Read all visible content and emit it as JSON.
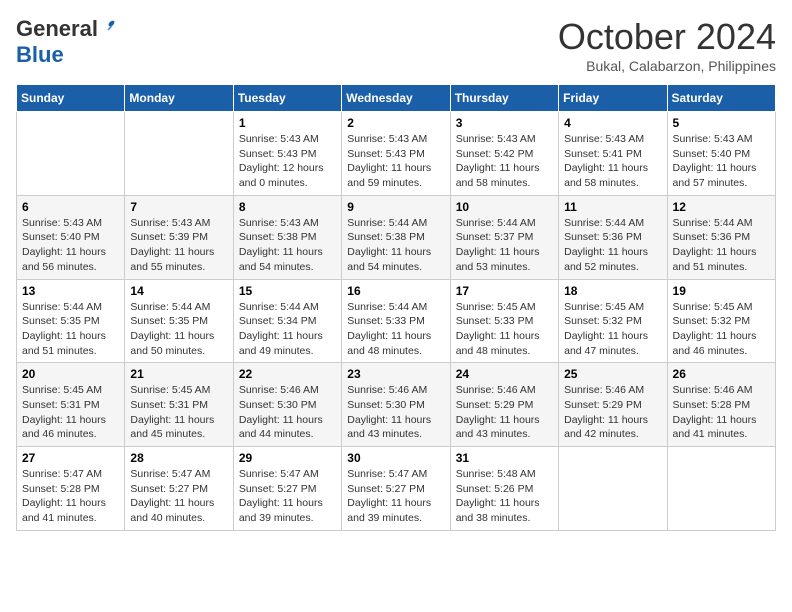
{
  "header": {
    "logo": {
      "line1": "General",
      "line2": "Blue"
    },
    "title": "October 2024",
    "location": "Bukal, Calabarzon, Philippines"
  },
  "calendar": {
    "days_of_week": [
      "Sunday",
      "Monday",
      "Tuesday",
      "Wednesday",
      "Thursday",
      "Friday",
      "Saturday"
    ],
    "weeks": [
      [
        {
          "day": "",
          "sunrise": "",
          "sunset": "",
          "daylight": ""
        },
        {
          "day": "",
          "sunrise": "",
          "sunset": "",
          "daylight": ""
        },
        {
          "day": "1",
          "sunrise": "Sunrise: 5:43 AM",
          "sunset": "Sunset: 5:43 PM",
          "daylight": "Daylight: 12 hours and 0 minutes."
        },
        {
          "day": "2",
          "sunrise": "Sunrise: 5:43 AM",
          "sunset": "Sunset: 5:43 PM",
          "daylight": "Daylight: 11 hours and 59 minutes."
        },
        {
          "day": "3",
          "sunrise": "Sunrise: 5:43 AM",
          "sunset": "Sunset: 5:42 PM",
          "daylight": "Daylight: 11 hours and 58 minutes."
        },
        {
          "day": "4",
          "sunrise": "Sunrise: 5:43 AM",
          "sunset": "Sunset: 5:41 PM",
          "daylight": "Daylight: 11 hours and 58 minutes."
        },
        {
          "day": "5",
          "sunrise": "Sunrise: 5:43 AM",
          "sunset": "Sunset: 5:40 PM",
          "daylight": "Daylight: 11 hours and 57 minutes."
        }
      ],
      [
        {
          "day": "6",
          "sunrise": "Sunrise: 5:43 AM",
          "sunset": "Sunset: 5:40 PM",
          "daylight": "Daylight: 11 hours and 56 minutes."
        },
        {
          "day": "7",
          "sunrise": "Sunrise: 5:43 AM",
          "sunset": "Sunset: 5:39 PM",
          "daylight": "Daylight: 11 hours and 55 minutes."
        },
        {
          "day": "8",
          "sunrise": "Sunrise: 5:43 AM",
          "sunset": "Sunset: 5:38 PM",
          "daylight": "Daylight: 11 hours and 54 minutes."
        },
        {
          "day": "9",
          "sunrise": "Sunrise: 5:44 AM",
          "sunset": "Sunset: 5:38 PM",
          "daylight": "Daylight: 11 hours and 54 minutes."
        },
        {
          "day": "10",
          "sunrise": "Sunrise: 5:44 AM",
          "sunset": "Sunset: 5:37 PM",
          "daylight": "Daylight: 11 hours and 53 minutes."
        },
        {
          "day": "11",
          "sunrise": "Sunrise: 5:44 AM",
          "sunset": "Sunset: 5:36 PM",
          "daylight": "Daylight: 11 hours and 52 minutes."
        },
        {
          "day": "12",
          "sunrise": "Sunrise: 5:44 AM",
          "sunset": "Sunset: 5:36 PM",
          "daylight": "Daylight: 11 hours and 51 minutes."
        }
      ],
      [
        {
          "day": "13",
          "sunrise": "Sunrise: 5:44 AM",
          "sunset": "Sunset: 5:35 PM",
          "daylight": "Daylight: 11 hours and 51 minutes."
        },
        {
          "day": "14",
          "sunrise": "Sunrise: 5:44 AM",
          "sunset": "Sunset: 5:35 PM",
          "daylight": "Daylight: 11 hours and 50 minutes."
        },
        {
          "day": "15",
          "sunrise": "Sunrise: 5:44 AM",
          "sunset": "Sunset: 5:34 PM",
          "daylight": "Daylight: 11 hours and 49 minutes."
        },
        {
          "day": "16",
          "sunrise": "Sunrise: 5:44 AM",
          "sunset": "Sunset: 5:33 PM",
          "daylight": "Daylight: 11 hours and 48 minutes."
        },
        {
          "day": "17",
          "sunrise": "Sunrise: 5:45 AM",
          "sunset": "Sunset: 5:33 PM",
          "daylight": "Daylight: 11 hours and 48 minutes."
        },
        {
          "day": "18",
          "sunrise": "Sunrise: 5:45 AM",
          "sunset": "Sunset: 5:32 PM",
          "daylight": "Daylight: 11 hours and 47 minutes."
        },
        {
          "day": "19",
          "sunrise": "Sunrise: 5:45 AM",
          "sunset": "Sunset: 5:32 PM",
          "daylight": "Daylight: 11 hours and 46 minutes."
        }
      ],
      [
        {
          "day": "20",
          "sunrise": "Sunrise: 5:45 AM",
          "sunset": "Sunset: 5:31 PM",
          "daylight": "Daylight: 11 hours and 46 minutes."
        },
        {
          "day": "21",
          "sunrise": "Sunrise: 5:45 AM",
          "sunset": "Sunset: 5:31 PM",
          "daylight": "Daylight: 11 hours and 45 minutes."
        },
        {
          "day": "22",
          "sunrise": "Sunrise: 5:46 AM",
          "sunset": "Sunset: 5:30 PM",
          "daylight": "Daylight: 11 hours and 44 minutes."
        },
        {
          "day": "23",
          "sunrise": "Sunrise: 5:46 AM",
          "sunset": "Sunset: 5:30 PM",
          "daylight": "Daylight: 11 hours and 43 minutes."
        },
        {
          "day": "24",
          "sunrise": "Sunrise: 5:46 AM",
          "sunset": "Sunset: 5:29 PM",
          "daylight": "Daylight: 11 hours and 43 minutes."
        },
        {
          "day": "25",
          "sunrise": "Sunrise: 5:46 AM",
          "sunset": "Sunset: 5:29 PM",
          "daylight": "Daylight: 11 hours and 42 minutes."
        },
        {
          "day": "26",
          "sunrise": "Sunrise: 5:46 AM",
          "sunset": "Sunset: 5:28 PM",
          "daylight": "Daylight: 11 hours and 41 minutes."
        }
      ],
      [
        {
          "day": "27",
          "sunrise": "Sunrise: 5:47 AM",
          "sunset": "Sunset: 5:28 PM",
          "daylight": "Daylight: 11 hours and 41 minutes."
        },
        {
          "day": "28",
          "sunrise": "Sunrise: 5:47 AM",
          "sunset": "Sunset: 5:27 PM",
          "daylight": "Daylight: 11 hours and 40 minutes."
        },
        {
          "day": "29",
          "sunrise": "Sunrise: 5:47 AM",
          "sunset": "Sunset: 5:27 PM",
          "daylight": "Daylight: 11 hours and 39 minutes."
        },
        {
          "day": "30",
          "sunrise": "Sunrise: 5:47 AM",
          "sunset": "Sunset: 5:27 PM",
          "daylight": "Daylight: 11 hours and 39 minutes."
        },
        {
          "day": "31",
          "sunrise": "Sunrise: 5:48 AM",
          "sunset": "Sunset: 5:26 PM",
          "daylight": "Daylight: 11 hours and 38 minutes."
        },
        {
          "day": "",
          "sunrise": "",
          "sunset": "",
          "daylight": ""
        },
        {
          "day": "",
          "sunrise": "",
          "sunset": "",
          "daylight": ""
        }
      ]
    ]
  }
}
